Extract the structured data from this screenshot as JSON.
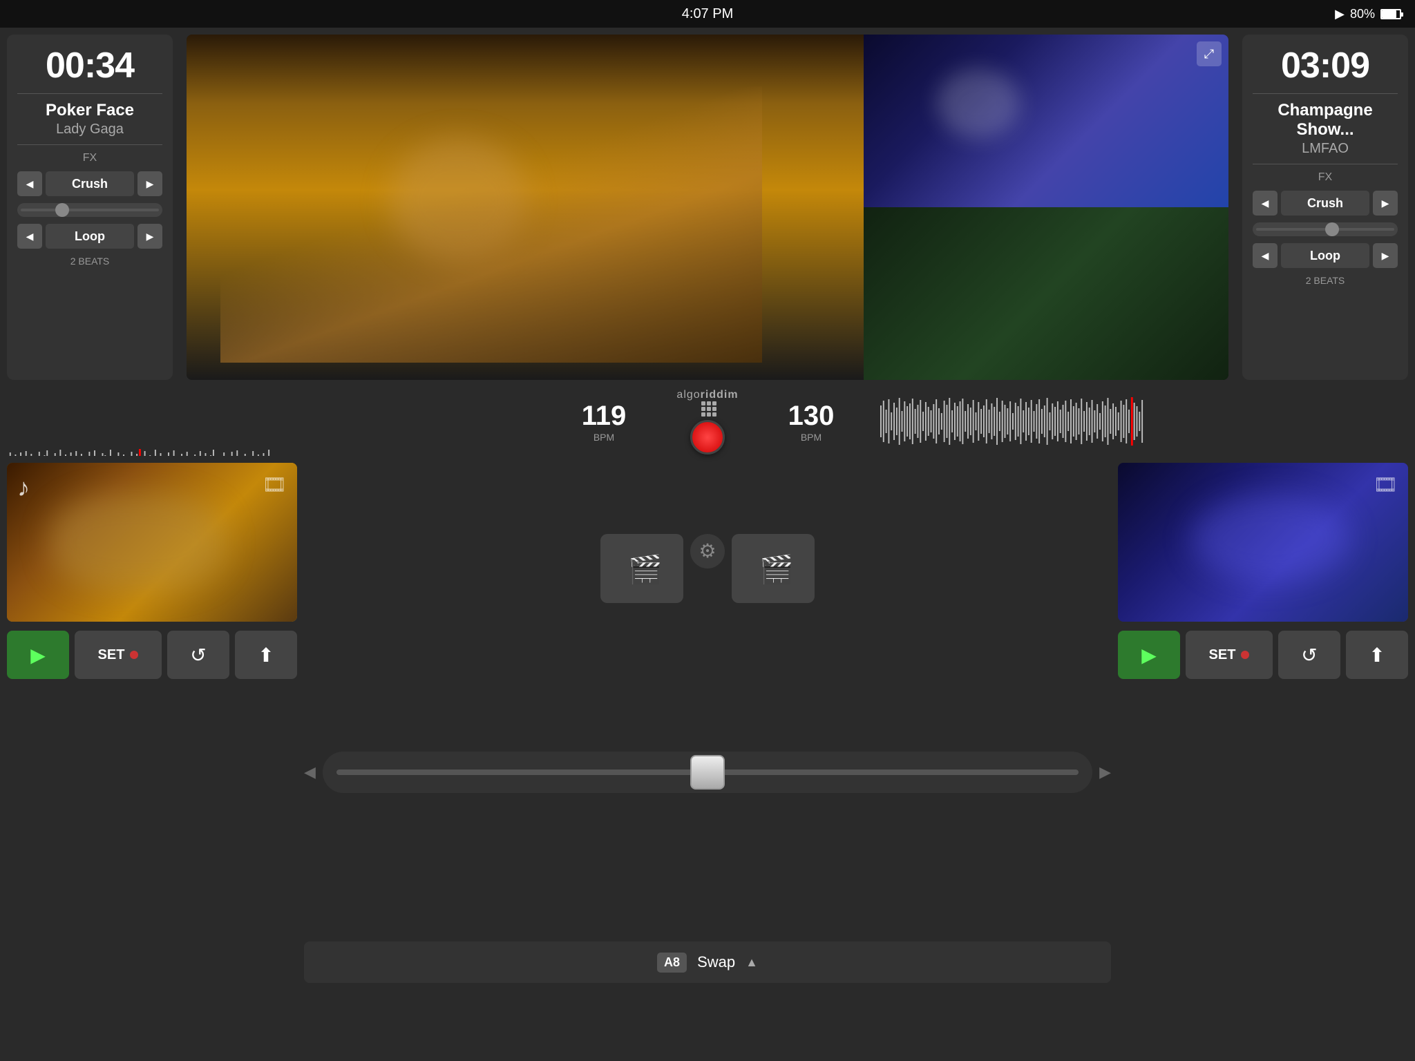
{
  "statusBar": {
    "time": "4:07 PM",
    "batteryPercent": "80%",
    "playIcon": "▶"
  },
  "leftDeck": {
    "timer": "00:34",
    "trackName": "Poker Face",
    "artistName": "Lady Gaga",
    "fxLabel": "FX",
    "fxName": "Crush",
    "loopName": "Loop",
    "loopBeats": "2 BEATS",
    "bpm": "119",
    "bpmLabel": "BPM",
    "sliderLeft": "25%"
  },
  "rightDeck": {
    "timer": "03:09",
    "trackName": "Champagne Show...",
    "artistName": "LMFAO",
    "fxLabel": "FX",
    "fxName": "Crush",
    "loopName": "Loop",
    "loopBeats": "2 BEATS",
    "bpm": "130",
    "bpmLabel": "BPM",
    "sliderLeft": "50%"
  },
  "centerControls": {
    "logoText": "algo",
    "logoTextBold": "riddim",
    "swapLabel": "Swap",
    "abLabel": "A8",
    "gearIcon": "⚙"
  },
  "bottomBar": {
    "playLabel": "▶",
    "setLabel": "SET",
    "rewindIcon": "↺",
    "shiftIcon": "⇧"
  }
}
